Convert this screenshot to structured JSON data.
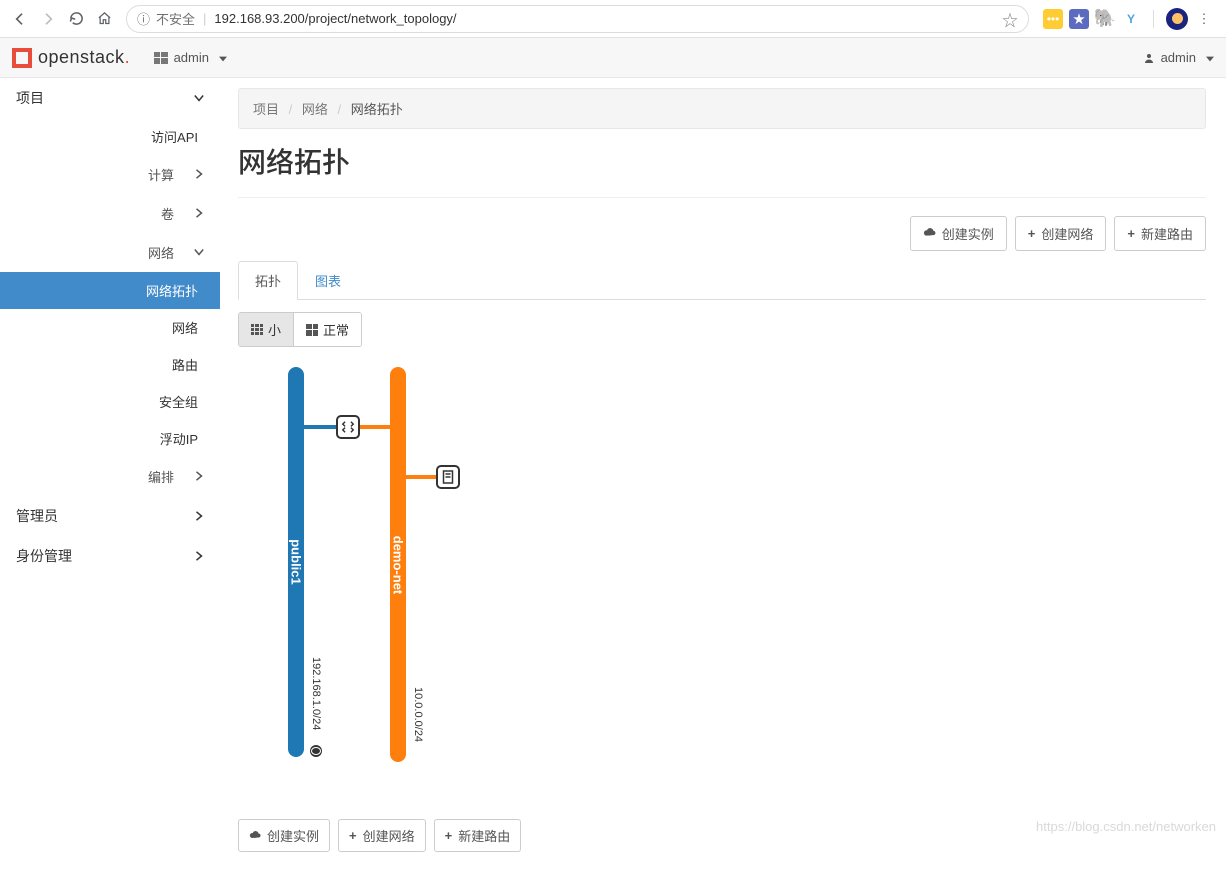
{
  "browser": {
    "security_label": "不安全",
    "url": "192.168.93.200/project/network_topology/",
    "menu_dots": "⋮",
    "star": "☆",
    "info": "ⓘ"
  },
  "topbar": {
    "brand": "openstack",
    "project": "admin",
    "user": "admin"
  },
  "sidebar": {
    "project": "项目",
    "access_api": "访问API",
    "compute": "计算",
    "volume": "卷",
    "network": "网络",
    "network_children": {
      "topology": "网络拓扑",
      "networks": "网络",
      "routers": "路由",
      "security_groups": "安全组",
      "floating_ips": "浮动IP"
    },
    "orchestration": "编排",
    "admin": "管理员",
    "identity": "身份管理"
  },
  "breadcrumb": {
    "project": "项目",
    "network": "网络",
    "current": "网络拓扑"
  },
  "page_title": "网络拓扑",
  "actions": {
    "launch_instance": "创建实例",
    "create_network": "创建网络",
    "create_router": "新建路由"
  },
  "tabs": {
    "topology": "拓扑",
    "graph": "图表"
  },
  "size_toggle": {
    "small": "小",
    "normal": "正常"
  },
  "topology": {
    "net1": {
      "name": "public1",
      "cidr": "192.168.1.0/24"
    },
    "net2": {
      "name": "demo-net",
      "cidr": "10.0.0.0/24"
    }
  },
  "watermark": "https://blog.csdn.net/networken"
}
